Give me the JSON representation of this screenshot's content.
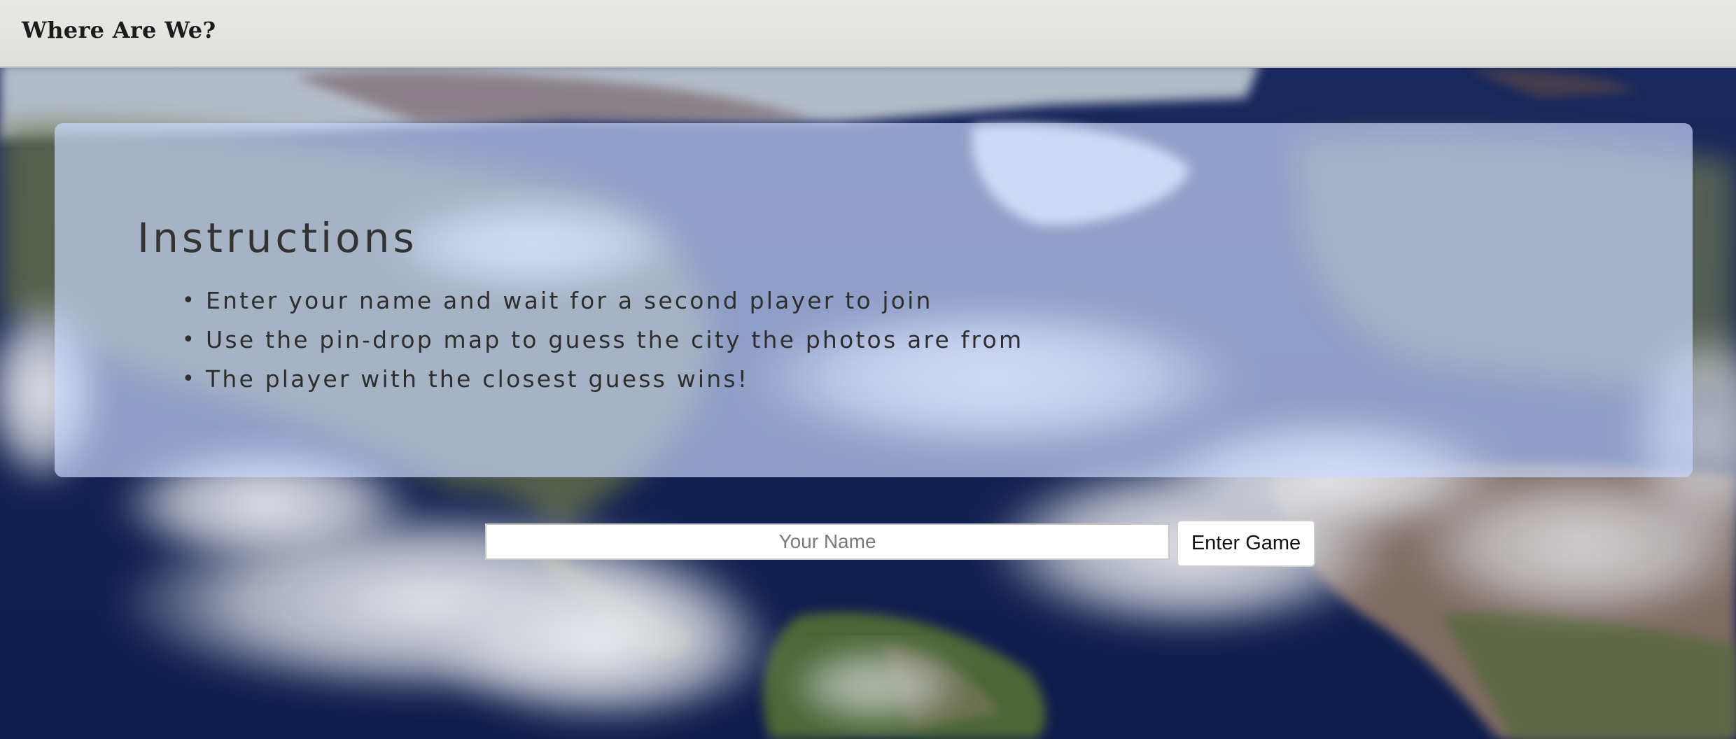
{
  "navbar": {
    "brand": "Where Are We?"
  },
  "instructions": {
    "title": "Instructions",
    "items": [
      "Enter your name and wait for a second player to join",
      "Use the pin-drop map to guess the city the photos are from",
      "The player with the closest guess wins!"
    ]
  },
  "join_form": {
    "name_placeholder": "Your Name",
    "name_value": "",
    "submit_label": "Enter Game"
  },
  "theme": {
    "navbar_bg": "#e3e3e0",
    "panel_bg": "#ccdaff",
    "ocean": "#152456"
  }
}
